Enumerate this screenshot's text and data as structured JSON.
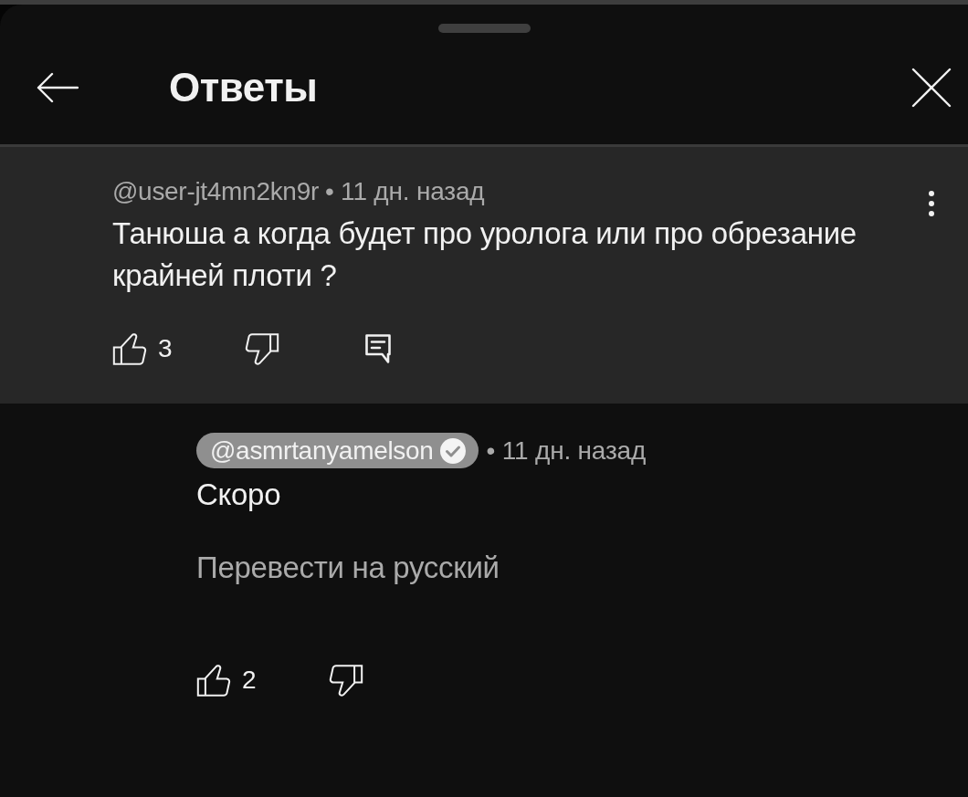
{
  "sheet": {
    "title": "Ответы"
  },
  "comments": [
    {
      "kind": "parent",
      "highlighted": true,
      "author": "@user-jt4mn2kn9r",
      "creator": false,
      "verified": false,
      "time": "• 11 дн. назад",
      "text": "Танюша а когда будет про уролога или про обрезание крайней плоти ?",
      "likes": "3",
      "can_reply": true
    },
    {
      "kind": "reply",
      "highlighted": false,
      "author": "@asmrtanyamelson",
      "creator": true,
      "verified": true,
      "time": "• 11 дн. назад",
      "text": "Скоро",
      "translate": "Перевести на русский",
      "likes": "2",
      "can_reply": false
    }
  ]
}
